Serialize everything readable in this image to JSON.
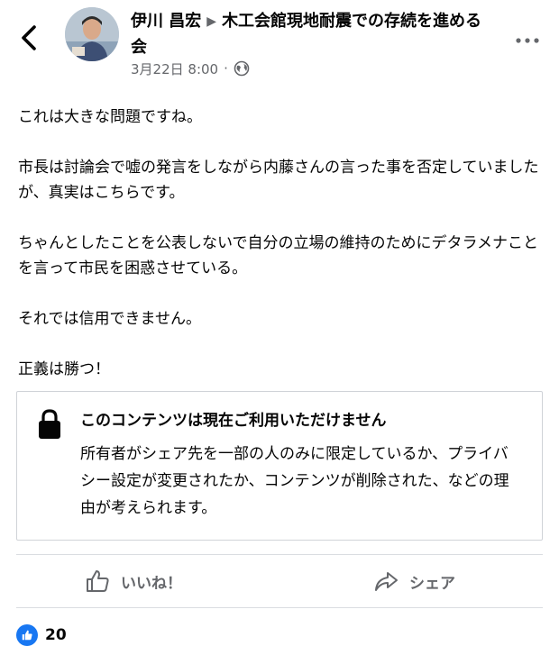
{
  "header": {
    "author": "伊川 昌宏",
    "group": "木工会館現地耐震での存続を進める会",
    "timestamp": "3月22日 8:00",
    "separator": "·",
    "audience_icon": "globe-icon"
  },
  "post": {
    "paragraphs": [
      "これは大きな問題ですね。",
      "市長は討論会で嘘の発言をしながら内藤さんの言った事を否定していましたが、真実はこちらです。",
      "ちゃんとしたことを公表しないで自分の立場の維持のためにデタラメナことを言って市民を困惑させている。",
      "それでは信用できません。",
      "正義は勝つ！"
    ]
  },
  "notice": {
    "icon": "lock-icon",
    "title": "このコンテンツは現在ご利用いただけません",
    "body": "所有者がシェア先を一部の人のみに限定しているか、プライバシー設定が変更されたか、コンテンツが削除された、などの理由が考えられます。"
  },
  "actions": {
    "like_label": "いいね！",
    "share_label": "シェア"
  },
  "reactions": {
    "count": "20"
  },
  "colors": {
    "accent": "#1877f2",
    "secondary_text": "#65676b",
    "divider": "#dadde1"
  }
}
